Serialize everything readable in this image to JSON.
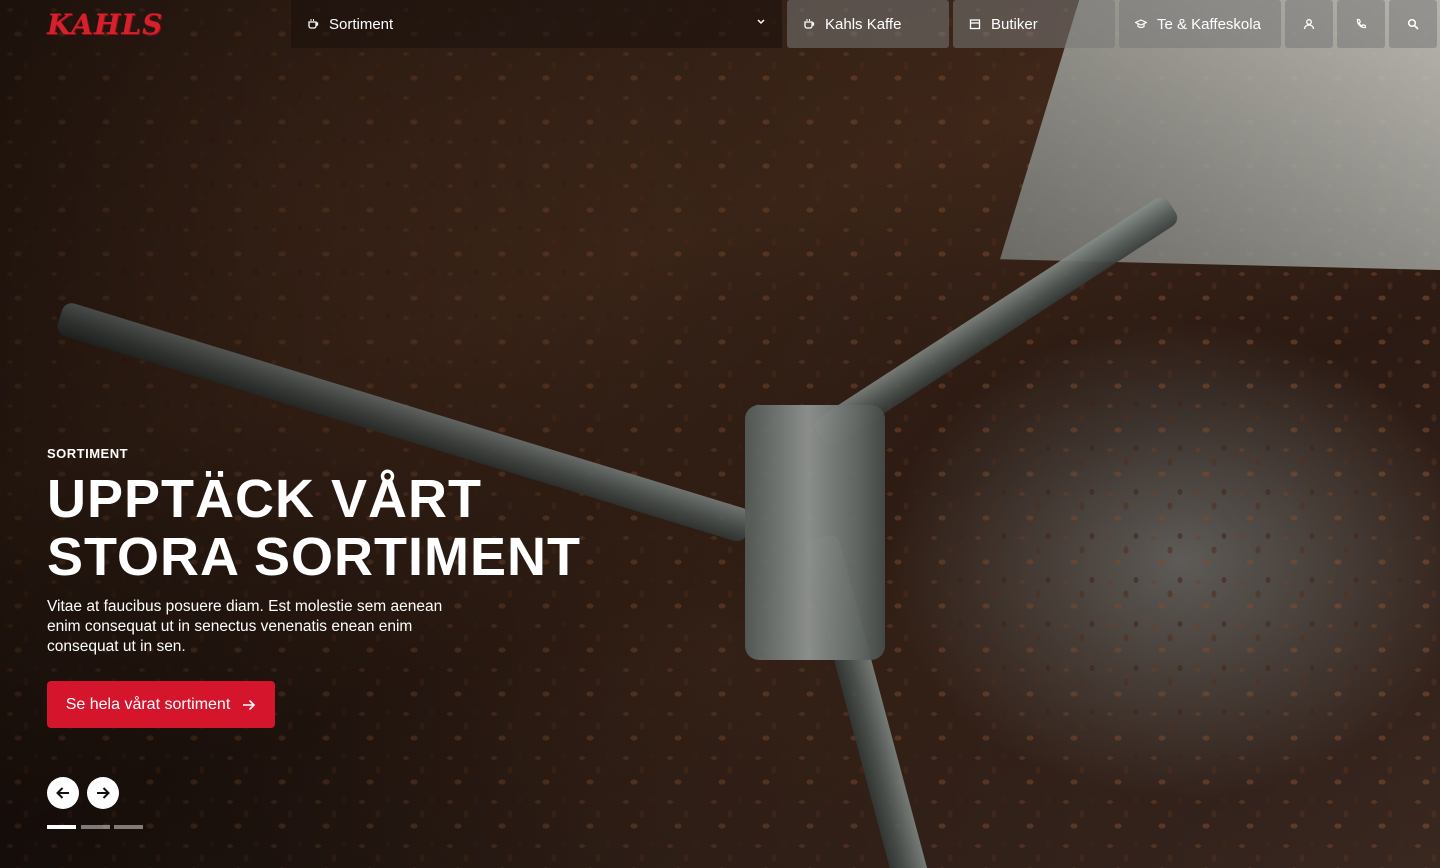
{
  "brand": {
    "logo_text": "KAHLS",
    "accent": "#d5152c"
  },
  "nav": {
    "sortiment_label": "Sortiment",
    "kahls_kaffe_label": "Kahls Kaffe",
    "butiker_label": "Butiker",
    "te_kaffeskola_label": "Te & Kaffeskola",
    "icons": [
      "user-icon",
      "phone-icon",
      "search-icon"
    ]
  },
  "hero": {
    "eyebrow": "SORTIMENT",
    "title_line1": "UPPTÄCK VÅRT",
    "title_line2": "STORA SORTIMENT",
    "description": "Vitae at faucibus posuere diam. Est molestie sem aenean enim consequat ut in senectus venenatis enean enim consequat ut in sen.",
    "cta_label": "Se hela vårat sortiment"
  },
  "carousel": {
    "slide_count": 3,
    "active_index": 0
  }
}
